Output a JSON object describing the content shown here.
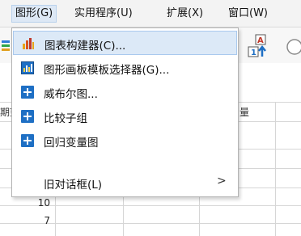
{
  "menubar": {
    "items": [
      {
        "label": "图形(G)"
      },
      {
        "label": "实用程序(U)"
      },
      {
        "label": "扩展(X)"
      },
      {
        "label": "窗口(W)"
      }
    ]
  },
  "graph_menu": {
    "items": [
      {
        "label": "图表构建器(C)...",
        "icon": "bar-chart-icon"
      },
      {
        "label": "图形画板模板选择器(G)...",
        "icon": "template-chooser-icon"
      },
      {
        "label": "威布尔图...",
        "icon": "plus-box-icon"
      },
      {
        "label": "比较子组",
        "icon": "plus-box-icon"
      },
      {
        "label": "回归变量图",
        "icon": "plus-box-icon"
      },
      {
        "label": "旧对话框(L)",
        "icon": "",
        "submenu_arrow": ">"
      }
    ]
  },
  "grid": {
    "col_header_left": "期望",
    "col_header_right": "量",
    "row_numbers": [
      "10",
      "7"
    ]
  },
  "colors": {
    "hover_bg": "#dce9f7",
    "accent_blue": "#1e6fc4"
  }
}
